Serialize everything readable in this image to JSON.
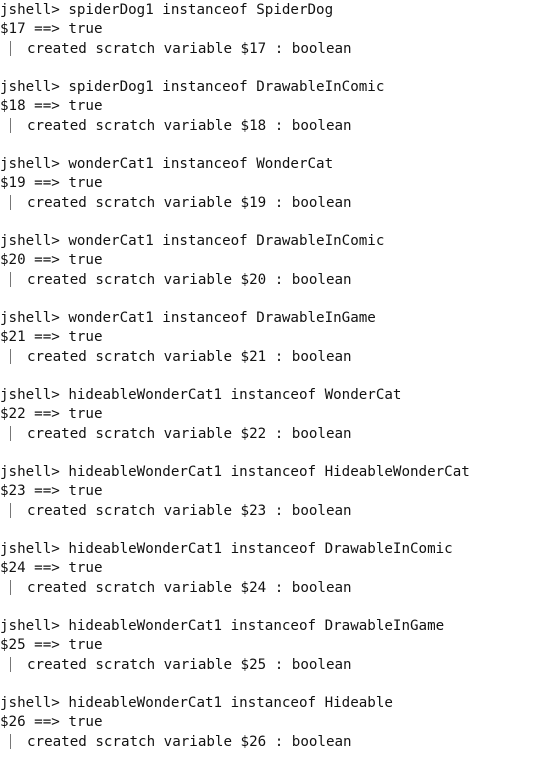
{
  "prompt": "jshell> ",
  "entries": [
    {
      "command": "spiderDog1 instanceof SpiderDog",
      "result": "$17 ==> true",
      "info": "created scratch variable $17 : boolean"
    },
    {
      "command": "spiderDog1 instanceof DrawableInComic",
      "result": "$18 ==> true",
      "info": "created scratch variable $18 : boolean"
    },
    {
      "command": "wonderCat1 instanceof WonderCat",
      "result": "$19 ==> true",
      "info": "created scratch variable $19 : boolean"
    },
    {
      "command": "wonderCat1 instanceof DrawableInComic",
      "result": "$20 ==> true",
      "info": "created scratch variable $20 : boolean"
    },
    {
      "command": "wonderCat1 instanceof DrawableInGame",
      "result": "$21 ==> true",
      "info": "created scratch variable $21 : boolean"
    },
    {
      "command": "hideableWonderCat1 instanceof WonderCat",
      "result": "$22 ==> true",
      "info": "created scratch variable $22 : boolean"
    },
    {
      "command": "hideableWonderCat1 instanceof HideableWonderCat",
      "result": "$23 ==> true",
      "info": "created scratch variable $23 : boolean"
    },
    {
      "command": "hideableWonderCat1 instanceof DrawableInComic",
      "result": "$24 ==> true",
      "info": "created scratch variable $24 : boolean"
    },
    {
      "command": "hideableWonderCat1 instanceof DrawableInGame",
      "result": "$25 ==> true",
      "info": "created scratch variable $25 : boolean"
    },
    {
      "command": "hideableWonderCat1 instanceof Hideable",
      "result": "$26 ==> true",
      "info": "created scratch variable $26 : boolean"
    }
  ]
}
